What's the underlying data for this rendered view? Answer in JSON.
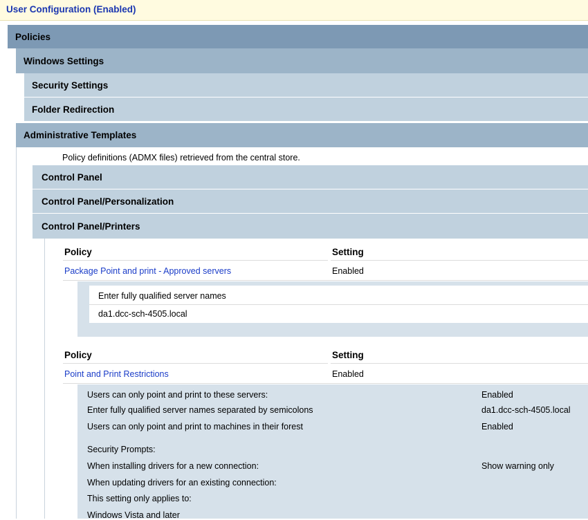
{
  "top": {
    "title": "User Configuration (Enabled)"
  },
  "sections": {
    "policies": "Policies",
    "windows_settings": "Windows Settings",
    "security_settings": "Security Settings",
    "folder_redirection": "Folder Redirection",
    "admin_templates": "Administrative Templates",
    "admx_note": "Policy definitions (ADMX files) retrieved from the central store.",
    "control_panel": "Control Panel",
    "control_panel_personalization": "Control Panel/Personalization",
    "control_panel_printers": "Control Panel/Printers"
  },
  "policy1": {
    "col_policy": "Policy",
    "col_setting": "Setting",
    "name": "Package Point and print - Approved servers",
    "setting": "Enabled",
    "box_label": "Enter fully qualified server names",
    "box_value": "da1.dcc-sch-4505.local"
  },
  "policy2": {
    "col_policy": "Policy",
    "col_setting": "Setting",
    "name": "Point and Print Restrictions",
    "setting": "Enabled",
    "rows": [
      {
        "label": "Users can only point and print to these servers:",
        "value": "Enabled"
      },
      {
        "label": "Enter fully qualified server names separated by semicolons",
        "value": "da1.dcc-sch-4505.local"
      },
      {
        "label": "Users can only point and print to machines in their forest",
        "value": "Enabled"
      },
      {
        "label": "Security Prompts:",
        "value": ""
      },
      {
        "label": "When installing drivers for a new connection:",
        "value": "Show warning only"
      },
      {
        "label": "When updating drivers for an existing connection:",
        "value": ""
      },
      {
        "label": "This setting only applies to:",
        "value": ""
      },
      {
        "label": "Windows Vista and later",
        "value": ""
      }
    ]
  }
}
